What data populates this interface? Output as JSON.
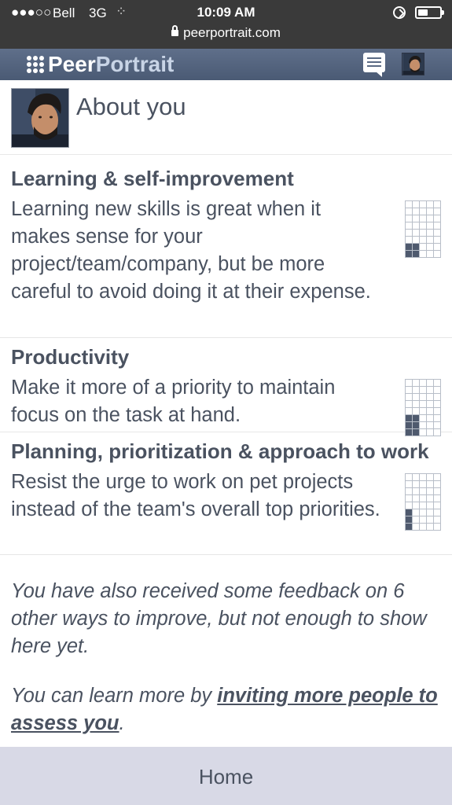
{
  "status_bar": {
    "signal": "●●●○○",
    "carrier": "Bell",
    "network": "3G",
    "activity": "⁘",
    "time": "10:09 AM",
    "battery_level": 0.45,
    "url": "peerportrait.com"
  },
  "app_header": {
    "brand_peer": "Peer",
    "brand_portrait": "Portrait",
    "messages_icon": "chat-bubble-icon",
    "profile_icon": "user-avatar"
  },
  "about": {
    "title": "About you"
  },
  "sections": [
    {
      "title": "Learning & self-improvement",
      "text": "Learning new skills is great when it makes sense for your project/team/company, but be more careful to avoid doing it at their expense."
    },
    {
      "title": "Productivity",
      "text": "Make it more of a priority to maintain focus on the task at hand."
    },
    {
      "title": "Planning, prioritization & approach to work",
      "text": "Resist the urge to work on pet projects instead of the team's overall top priorities."
    }
  ],
  "notes": {
    "feedback": "You have also received some feedback on 6 other ways to improve, but not enough to show here yet.",
    "learn_more_prefix": "You can learn more by ",
    "learn_more_link": "inviting more people to assess you",
    "learn_more_suffix": "."
  },
  "bottom_nav": {
    "home_label": "Home"
  },
  "colors": {
    "status_bar_bg": "#3a3a3a",
    "app_header_bg": "#546480",
    "text": "#4a5260",
    "bottom_nav_bg": "#d8d9e6"
  }
}
